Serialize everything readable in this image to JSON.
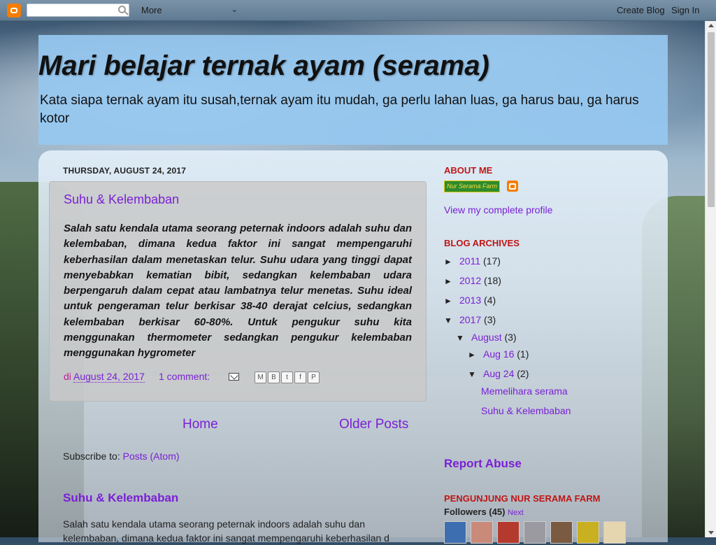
{
  "navbar": {
    "more_label": "More",
    "create_blog": "Create Blog",
    "sign_in": "Sign In"
  },
  "header": {
    "title": "Mari belajar ternak ayam (serama)",
    "description": "Kata siapa ternak ayam itu susah,ternak ayam itu mudah, ga perlu lahan luas, ga harus bau, ga harus kotor"
  },
  "post": {
    "date_header": "THURSDAY, AUGUST 24, 2017",
    "title": "Suhu & Kelembaban",
    "body": "Salah satu kendala utama seorang peternak indoors adalah suhu dan kelembaban, dimana kedua faktor ini sangat mempengaruhi keberhasilan dalam menetaskan telur. Suhu udara yang tinggi dapat menyebabkan kematian bibit, sedangkan kelembaban udara berpengaruh dalam cepat atau lambatnya telur menetas. Suhu ideal untuk pengeraman telur berkisar 38-40 derajat celcius, sedangkan kelembaban berkisar 60-80%. Untuk pengukur suhu kita menggunakan thermometer sedangkan pengukur kelembaban menggunakan hygrometer",
    "footer_di": "di",
    "footer_time": "August 24, 2017",
    "footer_comments": "1 comment:"
  },
  "pager": {
    "home": "Home",
    "older": "Older Posts"
  },
  "subscribe": {
    "label": "Subscribe to:",
    "link": "Posts (Atom)"
  },
  "popular": {
    "title": "Suhu & Kelembaban",
    "snippet": "Salah satu kendala utama seorang peternak indoors adalah suhu dan kelembaban, dimana kedua faktor ini sangat mempengaruhi keberhasilan d"
  },
  "sidebar": {
    "about_head": "ABOUT ME",
    "profile_img_text": "Nur Serama Farm",
    "view_profile": "View my complete profile",
    "archives_head": "BLOG ARCHIVES",
    "archives": [
      {
        "toggle": "►",
        "label": "2011",
        "count": "(17)"
      },
      {
        "toggle": "►",
        "label": "2012",
        "count": "(18)"
      },
      {
        "toggle": "►",
        "label": "2013",
        "count": "(4)"
      },
      {
        "toggle": "▼",
        "label": "2017",
        "count": "(3)"
      },
      {
        "toggle": "▼",
        "label": "August",
        "count": "(3)"
      },
      {
        "toggle": "►",
        "label": "Aug 16",
        "count": "(1)"
      },
      {
        "toggle": "▼",
        "label": "Aug 24",
        "count": "(2)"
      }
    ],
    "archive_posts": [
      "Memelihara serama",
      "Suhu & Kelembaban"
    ],
    "report_abuse": "Report Abuse",
    "visitors_head": "PENGUNJUNG NUR SERAMA FARM",
    "followers_label": "Followers (45)",
    "followers_next": "Next"
  },
  "colors": {
    "link": "#7a1fd6",
    "sidebar_heading": "#c01515",
    "header_bg": "#96c8f0",
    "blogger_orange": "#f57d00"
  }
}
